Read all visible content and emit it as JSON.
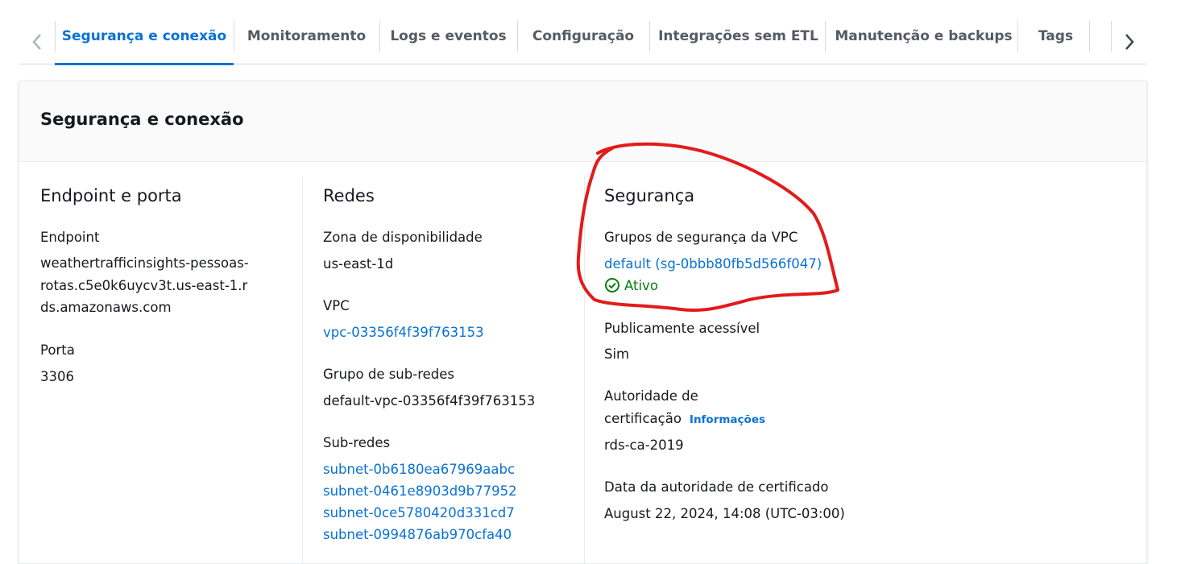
{
  "tabs": {
    "items": [
      {
        "label": "Segurança e conexão",
        "active": true
      },
      {
        "label": "Monitoramento"
      },
      {
        "label": "Logs e eventos"
      },
      {
        "label": "Configuração"
      },
      {
        "label": "Integrações sem ETL"
      },
      {
        "label": "Manutenção e backups"
      },
      {
        "label": "Tags"
      }
    ]
  },
  "panel": {
    "title": "Segurança e conexão",
    "endpoint": {
      "heading": "Endpoint e porta",
      "endpoint_label": "Endpoint",
      "endpoint_value": "weathertrafficinsights-pessoas-rotas.c5e0k6uycv3t.us-east-1.rds.amazonaws.com",
      "port_label": "Porta",
      "port_value": "3306"
    },
    "network": {
      "heading": "Redes",
      "az_label": "Zona de disponibilidade",
      "az_value": "us-east-1d",
      "vpc_label": "VPC",
      "vpc_value": "vpc-03356f4f39f763153",
      "subnet_group_label": "Grupo de sub-redes",
      "subnet_group_value": "default-vpc-03356f4f39f763153",
      "subnets_label": "Sub-redes",
      "subnets": [
        "subnet-0b6180ea67969aabc",
        "subnet-0461e8903d9b77952",
        "subnet-0ce5780420d331cd7",
        "subnet-0994876ab970cfa40"
      ]
    },
    "security": {
      "heading": "Segurança",
      "sg_label": "Grupos de segurança da VPC",
      "sg_value": "default (sg-0bbb80fb5d566f047)",
      "sg_status": "Ativo",
      "public_label": "Publicamente acessível",
      "public_value": "Sim",
      "ca_label": "Autoridade de certificação",
      "ca_info": "Informações",
      "ca_value": "rds-ca-2019",
      "ca_date_label": "Data da autoridade de certificado",
      "ca_date_value": "August 22, 2024, 14:08 (UTC-03:00)"
    }
  },
  "colors": {
    "accent": "#0972d3",
    "success": "#037f0c",
    "annotation": "#e21b1b"
  }
}
